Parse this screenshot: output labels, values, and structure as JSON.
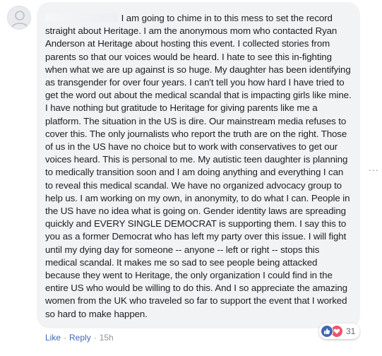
{
  "comment": {
    "text": "I am going to chime in to this mess to set the record straight about Heritage. I am the anonymous mom who contacted Ryan Anderson at Heritage about hosting this event. I collected stories from parents so that our voices would be heard. I hate to see this in-fighting when what we are up against is so huge. My daughter has been identifying as transgender for over four years. I can't tell you how hard I have tried to get the word out about the medical scandal that is impacting girls like mine. I have nothing but gratitude to Heritage for giving parents like me a platform. The situation in the US is dire. Our mainstream media refuses to cover this. The only journalists who report the truth are on the right. Those of us in the US have no choice but to work with conservatives to get our voices heard. This is personal to me. My autistic teen daughter is planning to medically transition soon and I am doing anything and everything I can to reveal this medical scandal. We have no organized advocacy group to help us. I am working on my own, in anonymity, to do what I can. People in the US have no idea what is going on. Gender identity laws are spreading quickly and EVERY SINGLE DEMOCRAT is supporting them. I say this to you as a former Democrat who has left my party over this issue. I will fight until my dying day for someone -- anyone -- left or right -- stops this medical scandal. It makes me so sad to see people being attacked because they went to Heritage, the only organization I could find in the entire US who would be willing to do this. And I so appreciate the amazing women from the UK who traveled so far to support the event that I worked so hard to make happen."
  },
  "actions": {
    "like_label": "Like",
    "separator": "·",
    "reply_label": "Reply",
    "timestamp": "15h"
  },
  "reactions": {
    "count": "31",
    "types": [
      "like-icon",
      "love-icon"
    ]
  },
  "menu": {
    "more_glyph": "..."
  },
  "colors": {
    "bubble_bg": "#f2f3f5",
    "text": "#1c1e21",
    "link": "#4267b2",
    "muted": "#90949c",
    "like": "#4267b2",
    "love": "#f25268"
  }
}
